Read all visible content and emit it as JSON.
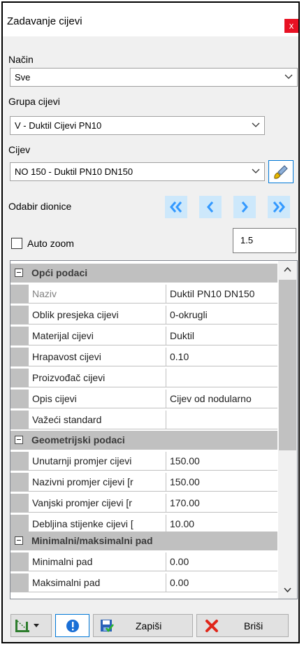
{
  "window": {
    "title": "Zadavanje cijevi",
    "close_glyph": "x"
  },
  "nacin": {
    "label": "Način",
    "value": "Sve"
  },
  "grupa": {
    "label": "Grupa cijevi",
    "value": "V - Duktil Cijevi PN10"
  },
  "cijev": {
    "label": "Cijev",
    "value": "NO 150 - Duktil PN10 DN150"
  },
  "dionice": {
    "label": "Odabir dionice"
  },
  "autozoom": {
    "label": "Auto zoom",
    "checked": false,
    "value": "1.5"
  },
  "properties": {
    "cat1": "Opći podaci",
    "rows1": [
      {
        "name": "Naziv",
        "value": "Duktil PN10 DN150",
        "readonly": true
      },
      {
        "name": "Oblik presjeka cijevi",
        "value": "0-okrugli"
      },
      {
        "name": "Materijal cijevi",
        "value": "Duktil"
      },
      {
        "name": "Hrapavost cijevi",
        "value": "0.10"
      },
      {
        "name": "Proizvođač cijevi",
        "value": ""
      },
      {
        "name": "Opis cijevi",
        "value": "Cijev od nodularno"
      },
      {
        "name": "Važeći standard",
        "value": ""
      }
    ],
    "cat2": "Geometrijski podaci",
    "rows2": [
      {
        "name": "Unutarnji promjer cijevi",
        "value": "150.00"
      },
      {
        "name": "Nazivni promjer cijevi [r",
        "value": "150.00"
      },
      {
        "name": "Vanjski promjer cijevi [r",
        "value": "170.00"
      },
      {
        "name": "Debljina stijenke cijevi [",
        "value": "10.00"
      }
    ],
    "cat3": "Minimalni/maksimalni pad",
    "rows3": [
      {
        "name": "Minimalni pad",
        "value": "0.00"
      },
      {
        "name": "Maksimalni pad",
        "value": "0.00"
      }
    ]
  },
  "buttons": {
    "save": "Zapiši",
    "delete": "Briši"
  },
  "colors": {
    "accent": "#0078d7",
    "nav_blue": "#3399ff",
    "close_red": "#e81123",
    "category_gray": "#c0c0c0"
  }
}
